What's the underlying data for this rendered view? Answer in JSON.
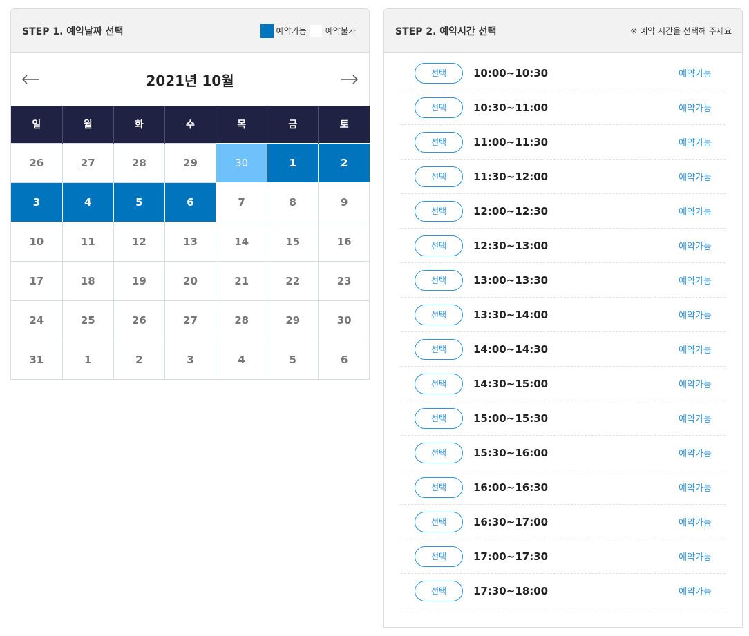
{
  "step1": {
    "title": "STEP 1. 예약날짜 선택",
    "legend": {
      "available": "예약가능",
      "unavailable": "예약불가"
    },
    "colors": {
      "available": "#0074bd",
      "today": "#6ec1fb",
      "header": "#1f2242"
    }
  },
  "calendar": {
    "month_title": "2021년 10월",
    "prev_icon": "arrow-left-icon",
    "next_icon": "arrow-right-icon",
    "weekdays": [
      "일",
      "월",
      "화",
      "수",
      "목",
      "금",
      "토"
    ],
    "weeks": [
      [
        {
          "d": "26",
          "s": "other"
        },
        {
          "d": "27",
          "s": "other"
        },
        {
          "d": "28",
          "s": "other"
        },
        {
          "d": "29",
          "s": "other"
        },
        {
          "d": "30",
          "s": "today"
        },
        {
          "d": "1",
          "s": "avail"
        },
        {
          "d": "2",
          "s": "avail"
        }
      ],
      [
        {
          "d": "3",
          "s": "avail"
        },
        {
          "d": "4",
          "s": "avail"
        },
        {
          "d": "5",
          "s": "avail"
        },
        {
          "d": "6",
          "s": "avail"
        },
        {
          "d": "7",
          "s": "normal"
        },
        {
          "d": "8",
          "s": "normal"
        },
        {
          "d": "9",
          "s": "normal"
        }
      ],
      [
        {
          "d": "10",
          "s": "normal"
        },
        {
          "d": "11",
          "s": "normal"
        },
        {
          "d": "12",
          "s": "normal"
        },
        {
          "d": "13",
          "s": "normal"
        },
        {
          "d": "14",
          "s": "normal"
        },
        {
          "d": "15",
          "s": "normal"
        },
        {
          "d": "16",
          "s": "normal"
        }
      ],
      [
        {
          "d": "17",
          "s": "normal"
        },
        {
          "d": "18",
          "s": "normal"
        },
        {
          "d": "19",
          "s": "normal"
        },
        {
          "d": "20",
          "s": "normal"
        },
        {
          "d": "21",
          "s": "normal"
        },
        {
          "d": "22",
          "s": "normal"
        },
        {
          "d": "23",
          "s": "normal"
        }
      ],
      [
        {
          "d": "24",
          "s": "normal"
        },
        {
          "d": "25",
          "s": "normal"
        },
        {
          "d": "26",
          "s": "normal"
        },
        {
          "d": "27",
          "s": "normal"
        },
        {
          "d": "28",
          "s": "normal"
        },
        {
          "d": "29",
          "s": "normal"
        },
        {
          "d": "30",
          "s": "normal"
        }
      ],
      [
        {
          "d": "31",
          "s": "normal"
        },
        {
          "d": "1",
          "s": "other"
        },
        {
          "d": "2",
          "s": "other"
        },
        {
          "d": "3",
          "s": "other"
        },
        {
          "d": "4",
          "s": "other"
        },
        {
          "d": "5",
          "s": "other"
        },
        {
          "d": "6",
          "s": "other"
        }
      ]
    ]
  },
  "step2": {
    "title": "STEP 2. 예약시간 선택",
    "note": "※ 예약 시간을 선택해 주세요",
    "select_label": "선택",
    "slots": [
      {
        "time": "10:00~10:30",
        "status": "예약가능"
      },
      {
        "time": "10:30~11:00",
        "status": "예약가능"
      },
      {
        "time": "11:00~11:30",
        "status": "예약가능"
      },
      {
        "time": "11:30~12:00",
        "status": "예약가능"
      },
      {
        "time": "12:00~12:30",
        "status": "예약가능"
      },
      {
        "time": "12:30~13:00",
        "status": "예약가능"
      },
      {
        "time": "13:00~13:30",
        "status": "예약가능"
      },
      {
        "time": "13:30~14:00",
        "status": "예약가능"
      },
      {
        "time": "14:00~14:30",
        "status": "예약가능"
      },
      {
        "time": "14:30~15:00",
        "status": "예약가능"
      },
      {
        "time": "15:00~15:30",
        "status": "예약가능"
      },
      {
        "time": "15:30~16:00",
        "status": "예약가능"
      },
      {
        "time": "16:00~16:30",
        "status": "예약가능"
      },
      {
        "time": "16:30~17:00",
        "status": "예약가능"
      },
      {
        "time": "17:00~17:30",
        "status": "예약가능"
      },
      {
        "time": "17:30~18:00",
        "status": "예약가능"
      }
    ]
  }
}
